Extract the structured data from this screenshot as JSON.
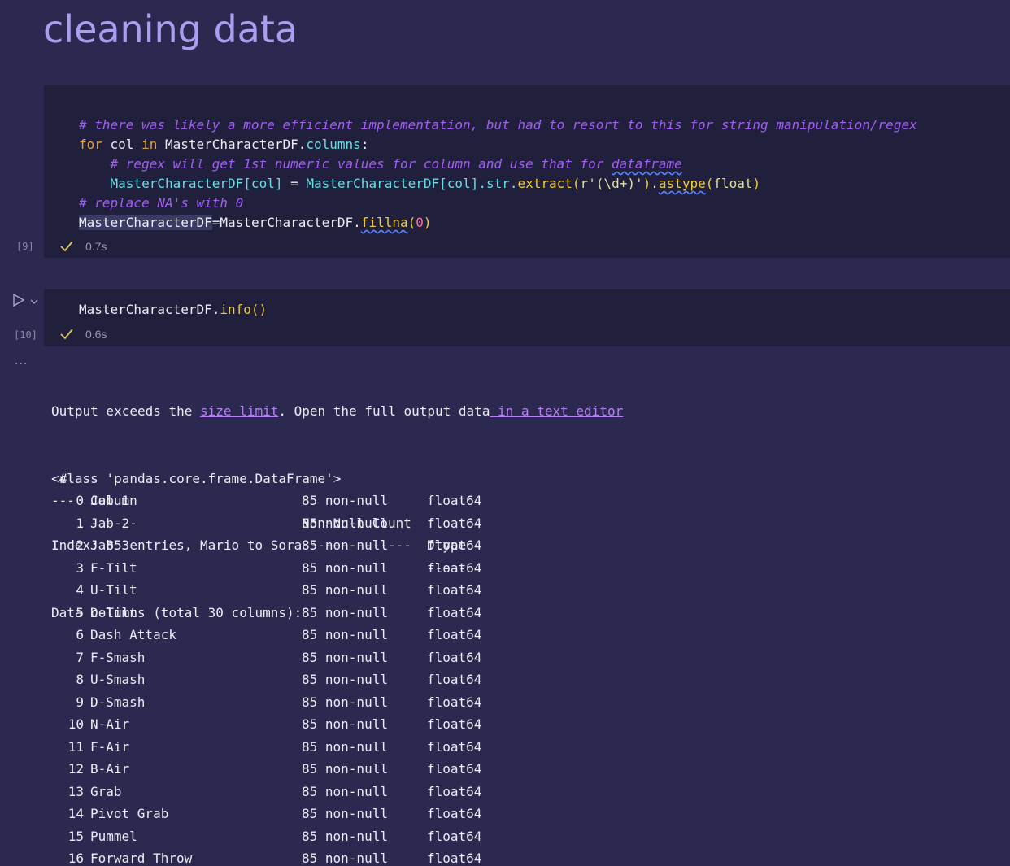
{
  "heading": "cleaning data",
  "cell1": {
    "exec_count": "[9]",
    "duration": "0.7s",
    "lines": {
      "l1_comment": "# there was likely a more efficient implementation, but had to resort to this for string manipulation/regex",
      "l2_for": "for",
      "l2_col": " col ",
      "l2_in": "in",
      "l2_obj": " MasterCharacterDF.",
      "l2_prop": "columns",
      "l2_colon": ":",
      "l3_comment_a": "    # regex will get 1st numeric values for column and use that for ",
      "l3_comment_b": "dataframe",
      "l4_indent": "    ",
      "l4_obj": "MasterCharacterDF",
      "l4_br1": "[col]",
      "l4_eq": " = ",
      "l4_obj2": "MasterCharacterDF",
      "l4_br2": "[col]",
      "l4_str": ".str.",
      "l4_extract": "extract",
      "l4_p1": "(",
      "l4_r": "r'",
      "l4_rx": "(\\d+)",
      "l4_q": "'",
      "l4_p2": ")",
      "l4_dot": ".",
      "l4_astype": "astype",
      "l4_p3": "(",
      "l4_float": "float",
      "l4_p4": ")",
      "l5_comment": "# replace NA's with 0",
      "l6_obj": "MasterCharacterDF",
      "l6_eq": "=",
      "l6_obj2": "MasterCharacterDF.",
      "l6_fillna": "fillna",
      "l6_p1": "(",
      "l6_zero": "0",
      "l6_p2": ")"
    }
  },
  "cell2": {
    "exec_count": "[10]",
    "duration": "0.6s",
    "code_obj": "MasterCharacterDF.",
    "code_fn": "info",
    "code_parens": "()"
  },
  "output": {
    "notice_a": "Output exceeds the ",
    "notice_link1": "size limit",
    "notice_b": ". Open the full output data",
    "notice_link2": " in a text editor",
    "line_class": "<class 'pandas.core.frame.DataFrame'>",
    "line_index": "Index: 85 entries, Mario to Sora",
    "line_cols": "Data columns (total 30 columns):",
    "headers": {
      "idx": "#",
      "column": "Column",
      "count": "Non-Null Count",
      "dtype": "Dtype"
    },
    "separators": {
      "idx": "---",
      "column": "------",
      "count": "--------------",
      "dtype": "-----"
    },
    "rows": [
      {
        "idx": "0",
        "column": "Jab 1",
        "count": "85 non-null",
        "dtype": "float64"
      },
      {
        "idx": "1",
        "column": "Jab 2",
        "count": "85 non-null",
        "dtype": "float64"
      },
      {
        "idx": "2",
        "column": "Jab 3",
        "count": "85 non-null",
        "dtype": "float64"
      },
      {
        "idx": "3",
        "column": "F-Tilt",
        "count": "85 non-null",
        "dtype": "float64"
      },
      {
        "idx": "4",
        "column": "U-Tilt",
        "count": "85 non-null",
        "dtype": "float64"
      },
      {
        "idx": "5",
        "column": "D-Tilt",
        "count": "85 non-null",
        "dtype": "float64"
      },
      {
        "idx": "6",
        "column": "Dash Attack",
        "count": "85 non-null",
        "dtype": "float64"
      },
      {
        "idx": "7",
        "column": "F-Smash",
        "count": "85 non-null",
        "dtype": "float64"
      },
      {
        "idx": "8",
        "column": "U-Smash",
        "count": "85 non-null",
        "dtype": "float64"
      },
      {
        "idx": "9",
        "column": "D-Smash",
        "count": "85 non-null",
        "dtype": "float64"
      },
      {
        "idx": "10",
        "column": "N-Air",
        "count": "85 non-null",
        "dtype": "float64"
      },
      {
        "idx": "11",
        "column": "F-Air",
        "count": "85 non-null",
        "dtype": "float64"
      },
      {
        "idx": "12",
        "column": "B-Air",
        "count": "85 non-null",
        "dtype": "float64"
      },
      {
        "idx": "13",
        "column": "Grab",
        "count": "85 non-null",
        "dtype": "float64"
      },
      {
        "idx": "14",
        "column": "Pivot Grab",
        "count": "85 non-null",
        "dtype": "float64"
      },
      {
        "idx": "15",
        "column": "Pummel",
        "count": "85 non-null",
        "dtype": "float64"
      },
      {
        "idx": "16",
        "column": "Forward Throw",
        "count": "85 non-null",
        "dtype": "float64"
      }
    ]
  }
}
